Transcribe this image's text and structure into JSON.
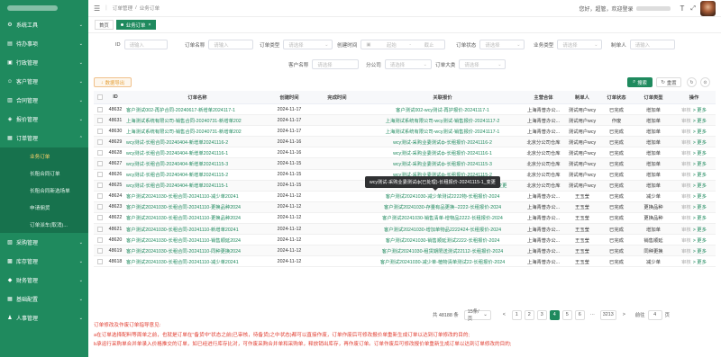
{
  "sidebar": {
    "items": [
      {
        "label": "系统工具",
        "icon": "gear-icon",
        "glyph": "⚙"
      },
      {
        "label": "待办事项",
        "icon": "list-icon",
        "glyph": "▤"
      },
      {
        "label": "行政管理",
        "icon": "briefcase-icon",
        "glyph": "▣"
      },
      {
        "label": "客户管理",
        "icon": "users-icon",
        "glyph": "☺"
      },
      {
        "label": "合同管理",
        "icon": "document-icon",
        "glyph": "▥"
      },
      {
        "label": "报价管理",
        "icon": "tag-icon",
        "glyph": "◈"
      },
      {
        "label": "订单管理",
        "icon": "cart-icon",
        "glyph": "▦"
      }
    ],
    "subitems": [
      {
        "label": "业务订单",
        "active": true
      },
      {
        "label": "长租合同订单",
        "active": false
      },
      {
        "label": "长租合同新选场单",
        "active": false
      },
      {
        "label": "申请佣货",
        "active": false
      },
      {
        "label": "订单派车(取消)...",
        "active": false
      }
    ],
    "bottom_items": [
      {
        "label": "采购管理",
        "icon": "bag-icon",
        "glyph": "▧"
      },
      {
        "label": "库存管理",
        "icon": "box-icon",
        "glyph": "▩"
      },
      {
        "label": "财务管理",
        "icon": "wallet-icon",
        "glyph": "◆"
      },
      {
        "label": "基础配置",
        "icon": "grid-icon",
        "glyph": "▦"
      },
      {
        "label": "人事管理",
        "icon": "person-icon",
        "glyph": "♟"
      }
    ]
  },
  "header": {
    "breadcrumb_root": "订单管理",
    "breadcrumb_sep": "/",
    "breadcrumb_current": "业务订单",
    "greeting": "您好，超管，欢迎登录",
    "font_size_glyph": "T"
  },
  "tabs": [
    {
      "label": "首页",
      "active": false
    },
    {
      "label": "业务订单",
      "active": true
    }
  ],
  "filters": {
    "id": {
      "label": "ID",
      "placeholder": "请输入"
    },
    "order_name": {
      "label": "订单名称",
      "placeholder": "请输入"
    },
    "order_type": {
      "label": "订单类型",
      "placeholder": "请选择"
    },
    "create_time": {
      "label": "创建时间",
      "start": "起始",
      "sep": "-",
      "end": "截止"
    },
    "order_status": {
      "label": "订单状态",
      "placeholder": "请选择"
    },
    "biz_type": {
      "label": "业务类型",
      "placeholder": "请选择"
    },
    "maker": {
      "label": "制单人",
      "placeholder": "请输入"
    },
    "customer": {
      "label": "客户名称",
      "placeholder": "请选择"
    },
    "branch": {
      "label": "分公司",
      "placeholder": "请选择"
    },
    "order_category": {
      "label": "订单大类",
      "placeholder": "请选择"
    }
  },
  "toolbar": {
    "export_label": "数据导出",
    "search_label": "搜索",
    "reset_label": "重置",
    "refresh_glyph": "↻",
    "columns_glyph": "⊙"
  },
  "table": {
    "headers": [
      "ID",
      "订单名称",
      "创建时间",
      "完成时间",
      "关联报价",
      "主营合体",
      "制单人",
      "订单状态",
      "订单类型",
      "操作"
    ],
    "rows": [
      {
        "id": "48632",
        "name": "客户测试002-再护合同-20240617-新增单2024117-1",
        "created": "2024-11-17",
        "finished": "",
        "quote": "客户测试002-wcy测试-再护报价-20241117-1",
        "company": "上海青普办公...",
        "maker": "测试用户wcy",
        "status": "已完成",
        "type": "增加单"
      },
      {
        "id": "48631",
        "name": "上海测试系统有限公司-销售合同-20240731-新增单202",
        "created": "2024-11-17",
        "finished": "",
        "quote": "上海测试系统有限公司-wcy测试-销售报价-20241117-2",
        "company": "上海青普办公...",
        "maker": "测试用户wcy",
        "status": "作废",
        "type": "增加单"
      },
      {
        "id": "48630",
        "name": "上海测试系统有限公司-销售合同-20240731-新增单202",
        "created": "2024-11-17",
        "finished": "",
        "quote": "上海测试系统有限公司-wcy测试-销售报价-20241117-1",
        "company": "上海青普办公...",
        "maker": "测试用户wcy",
        "status": "已完成",
        "type": "增加单"
      },
      {
        "id": "48629",
        "name": "wcy测试-长租合同-20240404-新增单20241116-2",
        "created": "2024-11-16",
        "finished": "",
        "quote": "wcy测试-采购业委测试ф-长租报价-20241116-2",
        "company": "北京分公司仓库",
        "maker": "测试用户wcy",
        "status": "已完成",
        "type": "增加单"
      },
      {
        "id": "48628",
        "name": "wcy测试-长租合同-20240404-新增单20241116-1",
        "created": "2024-11-16",
        "finished": "",
        "quote": "wcy测试-采购业委测试ф-长租报价-20241116-1",
        "company": "北京分公司仓库",
        "maker": "测试用户wcy",
        "status": "已完成",
        "type": "增加单"
      },
      {
        "id": "48627",
        "name": "wcy测试-长租合同-20240404-新增单20241115-3",
        "created": "2024-11-15",
        "finished": "",
        "quote": "wcy测试-采购业委测试ф-长租报价-20241115-3",
        "company": "北京分公司仓库",
        "maker": "测试用户wcy",
        "status": "已完成",
        "type": "增加单"
      },
      {
        "id": "48626",
        "name": "wcy测试-长租合同-20240404-新增单20241115-2",
        "created": "2024-11-15",
        "finished": "",
        "quote": "wcy测试-采购业委测试ф-长租报价-20241115-2",
        "company": "北京分公司仓库",
        "maker": "测试用户wcy",
        "status": "已完成",
        "type": "增加单"
      },
      {
        "id": "48625",
        "name": "wcy测试-长租合同-20240404-新增单20241115-1",
        "created": "2024-11-15",
        "finished": "",
        "quote": "wcy测试-采购业委测试ф(已处理)-长租报价-20241115-1_变更",
        "company": "北京分公司仓库",
        "maker": "测试用户wcy",
        "status": "已完成",
        "type": "增加单"
      },
      {
        "id": "48624",
        "name": "客户测试20241030-长租合同-20241110-减少单20241",
        "created": "2024-11-12",
        "finished": "",
        "quote": "客户测试20241030-减少单测试2222物-长租报价-2024",
        "company": "上海青普办公...",
        "maker": "王玉莹",
        "status": "已完成",
        "type": "减少单"
      },
      {
        "id": "48623",
        "name": "客户测试20241030-长租合同-20241110-更换品种2024",
        "created": "2024-11-12",
        "finished": "",
        "quote": "客户测试20241030-存量有品更换--2222-长租报价-2024",
        "company": "上海青普办公...",
        "maker": "王玉莹",
        "status": "已完成",
        "type": "更换品种"
      },
      {
        "id": "48622",
        "name": "客户测试20241030-长租合同-20241110-更换品种2024",
        "created": "2024-11-12",
        "finished": "",
        "quote": "客户测试20241030-销售清单-增物品2222-长租报价-2024",
        "company": "上海青普办公...",
        "maker": "王玉莹",
        "status": "已完成",
        "type": "更换品种"
      },
      {
        "id": "48621",
        "name": "客户测试20241030-长租合同-20241110-新增单20241",
        "created": "2024-11-12",
        "finished": "",
        "quote": "客户测试20241030-增加单物品2222424-长租报价-2024",
        "company": "上海青普办公...",
        "maker": "王玉莹",
        "status": "已完成",
        "type": "增加单"
      },
      {
        "id": "48620",
        "name": "客户测试20241030-长租合同-20241110-销售顺延2024",
        "created": "2024-11-12",
        "finished": "",
        "quote": "客户测试20241030-销售顺延测试2222-长租报价-2024",
        "company": "上海青普办公...",
        "maker": "王玉莹",
        "status": "已完成",
        "type": "销售顺延"
      },
      {
        "id": "48619",
        "name": "客户测试20241030-长租合同-20241110-同种更换2024",
        "created": "2024-11-12",
        "finished": "",
        "quote": "客户测试20241030-租赁期限送测试22112-长租报价-2024",
        "company": "上海青普办公...",
        "maker": "王玉莹",
        "status": "已完成",
        "type": "同种更换"
      },
      {
        "id": "48618",
        "name": "客户测试20241030-长租合同-20241110-减少单20241",
        "created": "2024-11-12",
        "finished": "",
        "quote": "客户测试20241030-减少单-植物清单测试22-长租报价-2024",
        "company": "上海青普办公...",
        "maker": "王玉莹",
        "status": "已完成",
        "type": "减少单"
      }
    ],
    "op_detail": "审核",
    "op_more": "> 更多"
  },
  "tooltip": "wcy测试-采购业委测试ф(已处理)-长租报价-20241115-1_变更",
  "pager": {
    "total": "共 48188 条",
    "page_size": "15条/页",
    "prev": "<",
    "pages": [
      "1",
      "2",
      "3",
      "4",
      "5",
      "6"
    ],
    "active_page": "4",
    "ellipsis": "···",
    "last": "3213",
    "next": ">",
    "goto_label": "前往",
    "goto_value": "4",
    "page_unit": "页"
  },
  "notes": {
    "title": "订单修改及作废订单指导意见:",
    "line1": "a在订单选择配料等周单之前，也就是订单在\"备货中\"状态之前(已审核，待备货)之中状态)都可以直接作废，订单作废后可修改报价单重新生成订单以达到订单修改的目的;",
    "line2": "b承运行采购单合并单录入价格推交的订单，如已经进行库存比对，可作废采购合并单和采购单，释放销出库存，再作废订单。订单作废后可修改报价单重新生成订单以达到订单修改的目的;"
  },
  "colors": {
    "brand": "#1f8a5e",
    "warning": "#e6a23c",
    "danger": "#e03b2e"
  }
}
